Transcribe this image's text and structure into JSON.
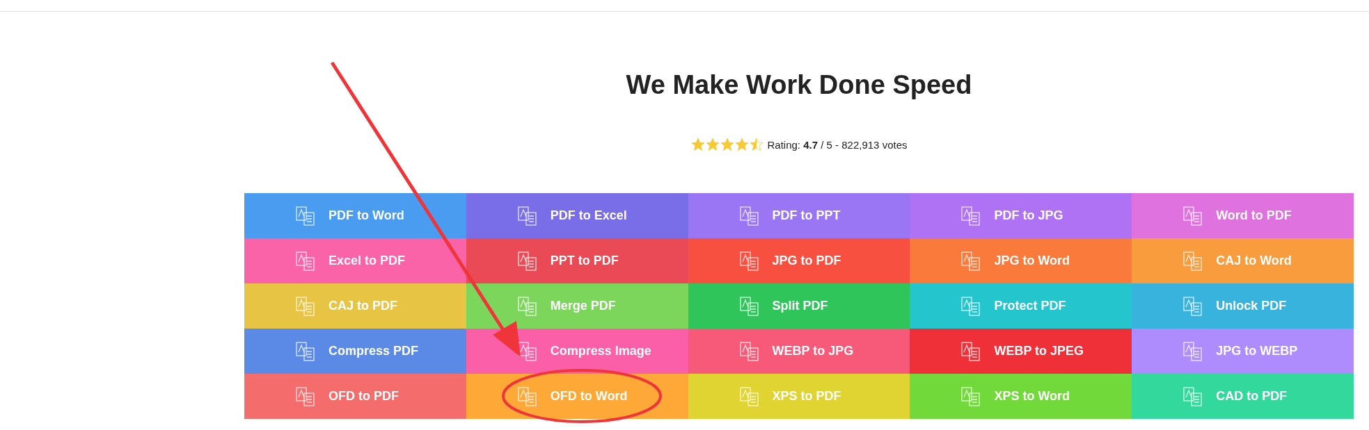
{
  "title": "We Make Work Done Speed",
  "rating": {
    "stars": 4.5,
    "text": "Rating: **4.7** / 5 - 822,913 votes"
  },
  "tools": [
    {
      "label": "PDF to Word",
      "color": "#4a9cf0"
    },
    {
      "label": "PDF to Excel",
      "color": "#7a6de8"
    },
    {
      "label": "PDF to PPT",
      "color": "#9a76f5"
    },
    {
      "label": "PDF to JPG",
      "color": "#b072f5"
    },
    {
      "label": "Word to PDF",
      "color": "#e072e0"
    },
    {
      "label": "Excel to PDF",
      "color": "#fb63a9"
    },
    {
      "label": "PPT to PDF",
      "color": "#ea4a55"
    },
    {
      "label": "JPG to PDF",
      "color": "#f75040"
    },
    {
      "label": "JPG to Word",
      "color": "#f97a3a"
    },
    {
      "label": "CAJ to Word",
      "color": "#f89c3e"
    },
    {
      "label": "CAJ to PDF",
      "color": "#e8c444"
    },
    {
      "label": "Merge PDF",
      "color": "#7dd65c"
    },
    {
      "label": "Split PDF",
      "color": "#2fc55a"
    },
    {
      "label": "Protect PDF",
      "color": "#24c5cc"
    },
    {
      "label": "Unlock PDF",
      "color": "#38b3de"
    },
    {
      "label": "Compress PDF",
      "color": "#5a8ae6"
    },
    {
      "label": "Compress Image",
      "color": "#fb5fa8"
    },
    {
      "label": "WEBP to JPG",
      "color": "#f75a78"
    },
    {
      "label": "WEBP to JPEG",
      "color": "#ef3038"
    },
    {
      "label": "JPG to WEBP",
      "color": "#ae8cfd"
    },
    {
      "label": "OFD to PDF",
      "color": "#f56c6c"
    },
    {
      "label": "OFD to Word",
      "color": "#fea838"
    },
    {
      "label": "XPS to PDF",
      "color": "#e0d432"
    },
    {
      "label": "XPS to Word",
      "color": "#72d93a"
    },
    {
      "label": "CAD to PDF",
      "color": "#33d89c"
    }
  ]
}
